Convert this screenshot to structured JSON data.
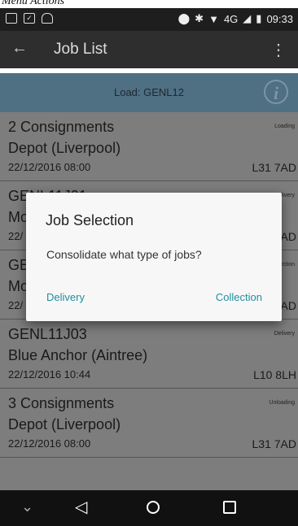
{
  "caption": "Menu Actions",
  "status_bar": {
    "network": "4G",
    "time": "09:33"
  },
  "app_bar": {
    "back": "←",
    "title": "Job List",
    "overflow": "⋮"
  },
  "load_bar": {
    "text": "Load: GENL12"
  },
  "jobs": [
    {
      "id": "2 Consignments",
      "status": "Loading",
      "name": "Depot (Liverpool)",
      "date": "22/12/2016 08:00",
      "postcode": "L31 7AD"
    },
    {
      "id": "GENL11J01",
      "status": "Delivery",
      "name": "Mo",
      "date": "22/",
      "postcode": "AD"
    },
    {
      "id": "GE",
      "status": "Collection",
      "name": "Mo",
      "date": "22/",
      "postcode": "AD"
    },
    {
      "id": "GENL11J03",
      "status": "Delivery",
      "name": "Blue Anchor (Aintree)",
      "date": "22/12/2016 10:44",
      "postcode": "L10 8LH"
    },
    {
      "id": "3 Consignments",
      "status": "Unloading",
      "name": "Depot (Liverpool)",
      "date": "22/12/2016 08:00",
      "postcode": "L31 7AD"
    }
  ],
  "dialog": {
    "title": "Job Selection",
    "message": "Consolidate what type of jobs?",
    "delivery_label": "Delivery",
    "collection_label": "Collection"
  },
  "colors": {
    "accent": "#1f8f9e",
    "load_bar": "#4f6f83",
    "app_bar": "#2e2e2e",
    "scrim_row": "#7d7d7d"
  }
}
